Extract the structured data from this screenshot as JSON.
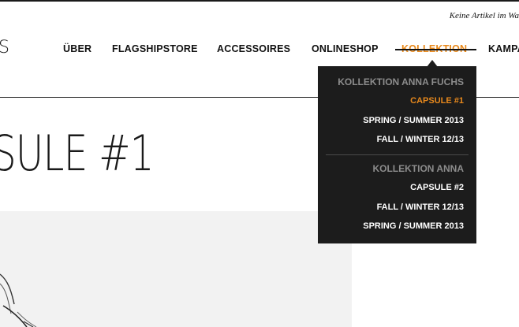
{
  "header": {
    "cart_status": "Keine Artikel im Wa",
    "logo_fragment": "S"
  },
  "nav": {
    "items": [
      {
        "label": "ÜBER",
        "active": false
      },
      {
        "label": "FLAGSHIPSTORE",
        "active": false
      },
      {
        "label": "ACCESSOIRES",
        "active": false
      },
      {
        "label": "ONLINESHOP",
        "active": false
      },
      {
        "label": "KOLLEKTION",
        "active": true
      },
      {
        "label": "KAMPA",
        "active": false
      }
    ]
  },
  "dropdown": {
    "groups": [
      {
        "heading": "KOLLEKTION ANNA FUCHS",
        "items": [
          {
            "label": "CAPSULE #1",
            "active": true
          },
          {
            "label": "SPRING / SUMMER 2013",
            "active": false
          },
          {
            "label": "FALL / WINTER 12/13",
            "active": false
          }
        ]
      },
      {
        "heading": "KOLLEKTION ANNA",
        "items": [
          {
            "label": "CAPSULE #2",
            "active": false
          },
          {
            "label": "FALL / WINTER 12/13",
            "active": false
          },
          {
            "label": "SPRING / SUMMER 2013",
            "active": false
          }
        ]
      }
    ]
  },
  "page": {
    "title": "SULE #1"
  },
  "colors": {
    "accent": "#e8891c",
    "dropdown_bg": "#1c1c1c",
    "dropdown_heading": "#8c8c8c",
    "text": "#111111"
  }
}
